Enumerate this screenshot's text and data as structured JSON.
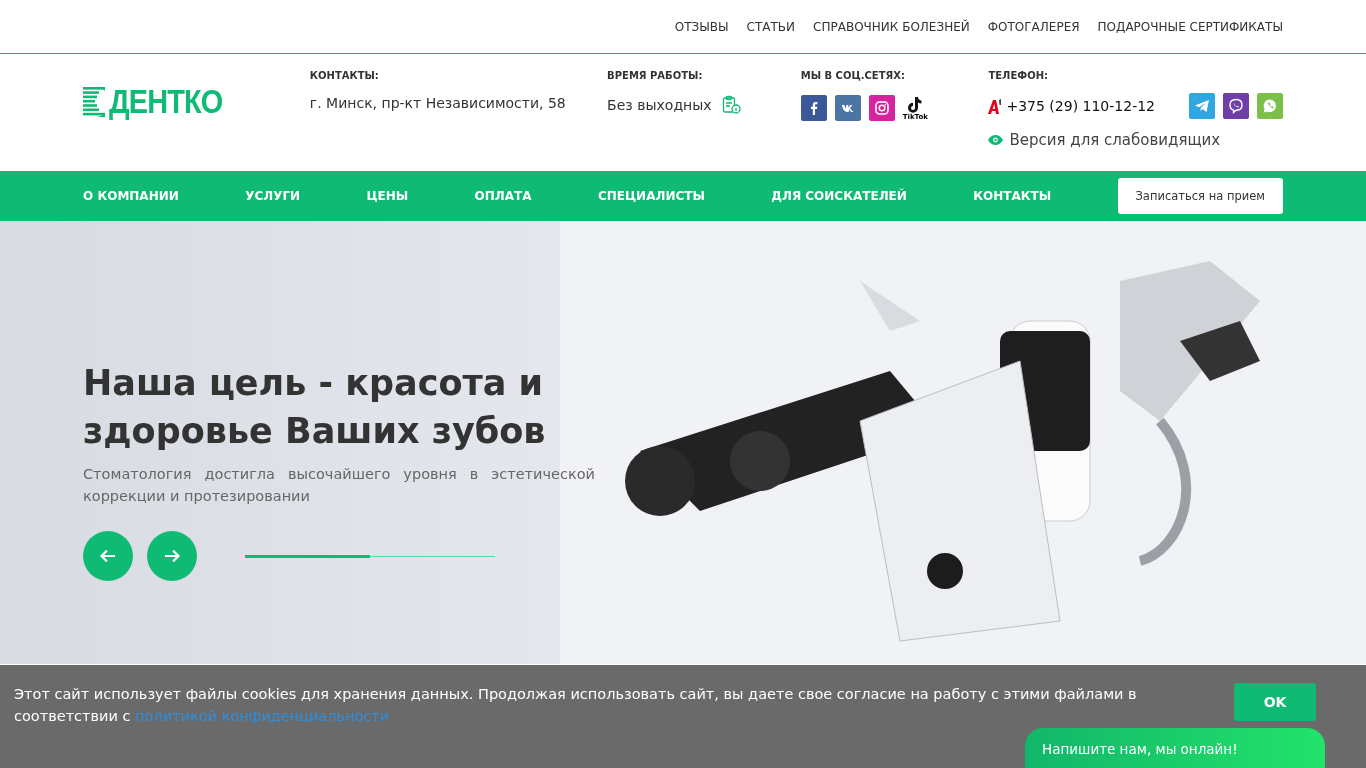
{
  "top_menu": [
    "ОТЗЫВЫ",
    "СТАТЬИ",
    "СПРАВОЧНИК БОЛЕЗНЕЙ",
    "ФОТОГАЛЕРЕЯ",
    "ПОДАРОЧНЫЕ СЕРТИФИКАТЫ"
  ],
  "logo": {
    "text": "ДЕНТКО"
  },
  "contacts": {
    "heading": "КОНТАКТЫ:",
    "address": "г. Минск, пр-кт Независимости, 58"
  },
  "hours": {
    "heading": "ВРЕМЯ РАБОТЫ:",
    "value": "Без выходных"
  },
  "social": {
    "heading": "МЫ В СОЦ.СЕТЯХ:",
    "items": [
      {
        "kind": "facebook",
        "color": "#3b5998"
      },
      {
        "kind": "vk",
        "color": "#4c75a3"
      },
      {
        "kind": "instagram",
        "color": "#d6249f"
      },
      {
        "kind": "tiktok",
        "label": "TikTok"
      }
    ]
  },
  "phone": {
    "heading": "ТЕЛЕФОН:",
    "number": "+375 (29) 110-12-12",
    "messengers": [
      {
        "kind": "telegram",
        "color": "#2fa7e0"
      },
      {
        "kind": "viber",
        "color": "#6f3ea8"
      },
      {
        "kind": "whatsapp",
        "color": "#7cc04a"
      }
    ],
    "accessibility": "Версия для слабовидящих"
  },
  "nav": {
    "items": [
      "О КОМПАНИИ",
      "УСЛУГИ",
      "ЦЕНЫ",
      "ОПЛАТА",
      "СПЕЦИАЛИСТЫ",
      "ДЛЯ СОИСКАТЕЛЕЙ",
      "КОНТАКТЫ"
    ],
    "button": "Записаться на прием"
  },
  "hero": {
    "title": "Наша цель - красота и здоровье Ваших зубов",
    "subtitle": "Стоматология достигла высочайшего уровня в эстетической коррекции и протезировании",
    "progress": {
      "level": 0.5
    }
  },
  "cookie": {
    "text": "Этот сайт использует файлы cookies для хранения данных. Продолжая использовать сайт, вы даете свое согласие на работу с этими файлами в соответствии с",
    "link": "политикой конфиденциальности",
    "button": "OK"
  },
  "chat": {
    "label": "Напишите нам, мы онлайн!"
  }
}
